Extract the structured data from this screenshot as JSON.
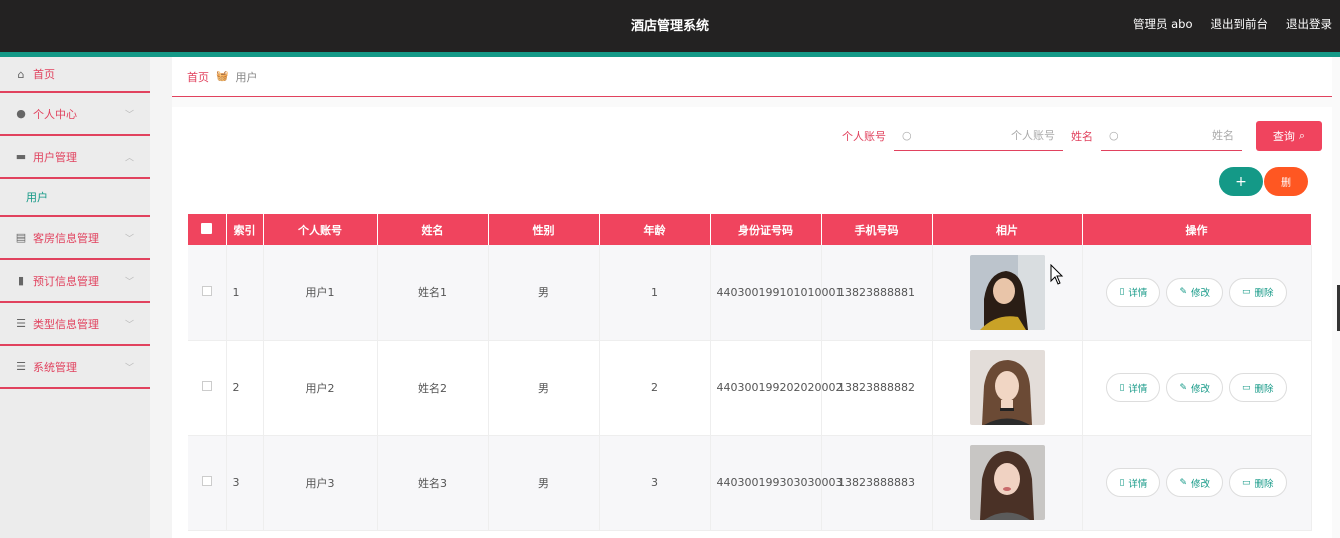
{
  "header": {
    "title": "酒店管理系统",
    "admin": "管理员 abo",
    "to_front": "退出到前台",
    "logout": "退出登录"
  },
  "sidebar": {
    "items": [
      {
        "label": "首页",
        "icon": "home-icon"
      },
      {
        "label": "个人中心",
        "icon": "user-icon"
      },
      {
        "label": "用户管理",
        "icon": "briefcase-icon",
        "sub": "用户"
      },
      {
        "label": "客房信息管理",
        "icon": "clipboard-icon"
      },
      {
        "label": "预订信息管理",
        "icon": "bar-chart-icon"
      },
      {
        "label": "类型信息管理",
        "icon": "list-icon"
      },
      {
        "label": "系统管理",
        "icon": "list-icon"
      }
    ]
  },
  "breadcrumb": {
    "home": "首页",
    "current": "用户"
  },
  "search": {
    "account_label": "个人账号",
    "account_placeholder": "个人账号",
    "name_label": "姓名",
    "name_placeholder": "姓名",
    "query_button": "查询"
  },
  "toolbar": {
    "add": "+",
    "delete": "删"
  },
  "table": {
    "columns": [
      "索引",
      "个人账号",
      "姓名",
      "性别",
      "年龄",
      "身份证号码",
      "手机号码",
      "相片",
      "操作"
    ],
    "rows": [
      {
        "index": "1",
        "account": "用户1",
        "name": "姓名1",
        "gender": "男",
        "age": "1",
        "id_number": "440300199101010001",
        "phone": "13823888881"
      },
      {
        "index": "2",
        "account": "用户2",
        "name": "姓名2",
        "gender": "男",
        "age": "2",
        "id_number": "440300199202020002",
        "phone": "13823888882"
      },
      {
        "index": "3",
        "account": "用户3",
        "name": "姓名3",
        "gender": "男",
        "age": "3",
        "id_number": "440300199303030003",
        "phone": "13823888883"
      }
    ],
    "actions": {
      "detail": "详情",
      "edit": "修改",
      "remove": "删除"
    }
  },
  "colors": {
    "accent": "#f0445e",
    "teal": "#149987",
    "orange": "#ff5722",
    "header_bg": "#232222"
  }
}
